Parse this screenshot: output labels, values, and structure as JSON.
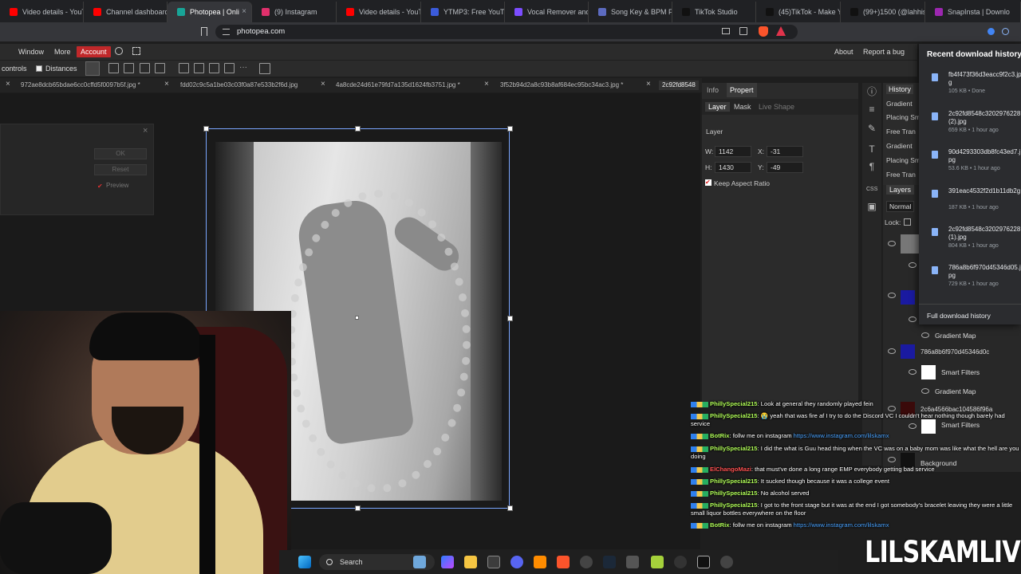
{
  "browser": {
    "tabs": [
      {
        "label": "Video details - YouT",
        "color": "#ff0000"
      },
      {
        "label": "Channel dashboard",
        "color": "#ff0000"
      },
      {
        "label": "Photopea | Onli",
        "color": "#18a497",
        "active": true
      },
      {
        "label": "(9) Instagram",
        "color": "#e1306c"
      },
      {
        "label": "Video details - YouT",
        "color": "#ff0000"
      },
      {
        "label": "YTMP3: Free YouTub",
        "color": "#3b5bdb"
      },
      {
        "label": "Vocal Remover and",
        "color": "#7c4dff"
      },
      {
        "label": "Song Key & BPM Fi",
        "color": "#5c6bc0"
      },
      {
        "label": "TikTok Studio",
        "color": "#111111"
      },
      {
        "label": "(45)TikTok - Make Y",
        "color": "#111111"
      },
      {
        "label": "(99+)1500 (@lahhis",
        "color": "#111111"
      },
      {
        "label": "SnapInsta | Downlo",
        "color": "#9c27b0"
      }
    ],
    "url": "photopea.com"
  },
  "menubar": {
    "items": [
      "Window",
      "More"
    ],
    "account": "Account",
    "right_items": [
      "About",
      "Report a bug"
    ]
  },
  "optbar": {
    "controls_label": "controls",
    "distances_label": "Distances"
  },
  "doctabs": [
    "972ae8dcb65bdae6cc0cffd5f0097b5f.jpg *",
    "fdd02c9c5a1be03c03f0a87e533b2f6d.jpg",
    "4a8cde24d61e79fd7a135d1624fb3751.jpg *",
    "3f52b94d2a8c93b8af684ec95bc34ac3.jpg *",
    "2c92fd8548"
  ],
  "dialog": {
    "ok": "OK",
    "reset": "Reset",
    "preview": "Preview"
  },
  "props": {
    "tab_info": "Info",
    "tab_properties": "Propert",
    "sub_layer": "Layer",
    "sub_mask": "Mask",
    "sub_live": "Live Shape",
    "section": "Layer",
    "w_label": "W:",
    "w_value": "1142",
    "h_label": "H:",
    "h_value": "1430",
    "x_label": "X:",
    "x_value": "-31",
    "y_label": "Y:",
    "y_value": "-49",
    "keep_aspect": "Keep Aspect Ratio"
  },
  "history": {
    "tab": "History",
    "items": [
      "Gradient",
      "Placing Sm",
      "Free Tran",
      "Gradient",
      "Placing Sm",
      "Free Tran"
    ]
  },
  "layers": {
    "tab": "Layers",
    "blend": "Normal",
    "lock": "Lock:",
    "rows": [
      {
        "label": "Gradient Map",
        "kind": "sub"
      },
      {
        "label": "786a8b6f970d45346d0c",
        "kind": "layer"
      },
      {
        "label": "Smart Filters",
        "kind": "sub"
      },
      {
        "label": "Gradient Map",
        "kind": "sub"
      },
      {
        "label": "2c6a4566bac104586f96a",
        "kind": "layer"
      },
      {
        "label": "Smart Filters",
        "kind": "sub"
      },
      {
        "label": "Background",
        "kind": "layer"
      }
    ]
  },
  "downloads": {
    "title": "Recent download history",
    "items": [
      {
        "name": "fb4f473f36d3eacc9f2c3.jpg",
        "meta": "105 KB • Done"
      },
      {
        "name": "2c92fd8548c3202976228 (2).jpg",
        "meta": "659 KB • 1 hour ago"
      },
      {
        "name": "90d4293303db8fc43ed7.jpg",
        "meta": "53.6 KB • 1 hour ago"
      },
      {
        "name": "391eac4532f2d1b11db2g",
        "meta": "187 KB • 1 hour ago"
      },
      {
        "name": "2c92fd8548c3202976228 (1).jpg",
        "meta": "804 KB • 1 hour ago"
      },
      {
        "name": "786a8b6f970d45346d05.jpg",
        "meta": "729 KB • 1 hour ago"
      }
    ],
    "full": "Full download history"
  },
  "chat": [
    {
      "name": "PhillySpecial215",
      "color": "#b2ff59",
      "text": ": Look at general they randomly played fein"
    },
    {
      "name": "PhillySpecial215",
      "color": "#b2ff59",
      "text": ": 😭 yeah that was fire af I try to do the Discord VC I couldn't hear nothing though barely had service"
    },
    {
      "name": "BotRix",
      "color": "#b2ff59",
      "text": ": follw me on instagram ",
      "link": "https://www.instagram.com/lilskamx"
    },
    {
      "name": "PhillySpecial215",
      "color": "#b2ff59",
      "text": ": I did the what is Guu head thing when the VC was on a baby mom was like what the hell are you doing"
    },
    {
      "name": "ElChangoMazi",
      "color": "#ff5252",
      "text": ": that must've done a long range EMP everybody getting bad service"
    },
    {
      "name": "PhillySpecial215",
      "color": "#b2ff59",
      "text": ": It sucked though because it was a college event"
    },
    {
      "name": "PhillySpecial215",
      "color": "#b2ff59",
      "text": ": No alcohol served"
    },
    {
      "name": "PhillySpecial215",
      "color": "#b2ff59",
      "text": ": I got to the front stage but it was at the end I got somebody's bracelet leaving they were a little small liquor bottles everywhere on the floor"
    },
    {
      "name": "BotRix",
      "color": "#b2ff59",
      "text": ": follw me on instagram ",
      "link": "https://www.instagram.com/lilskamx"
    }
  ],
  "taskbar": {
    "search": "Search"
  },
  "watermark": "LILSKAMLIVE"
}
